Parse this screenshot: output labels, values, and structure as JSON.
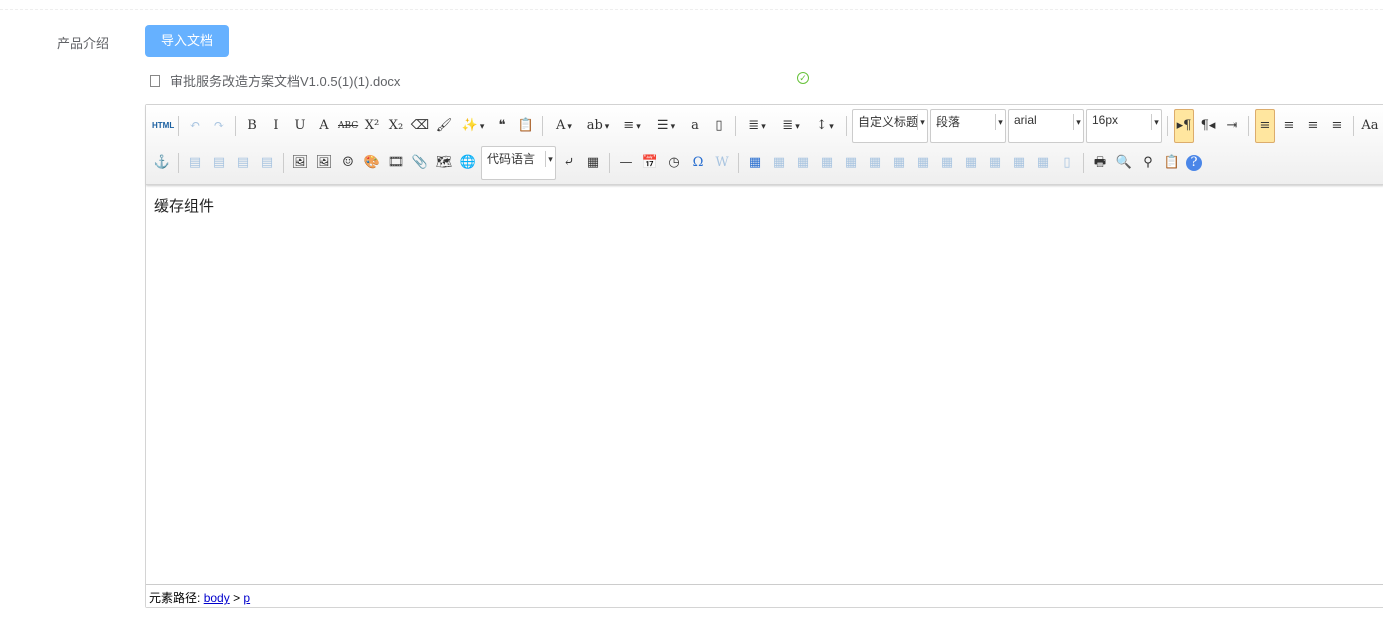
{
  "form": {
    "label": "产品介绍",
    "import_button": "导入文档",
    "file_name": "审批服务改造方案文档V1.0.5(1)(1).docx"
  },
  "toolbar": {
    "row1": [
      {
        "n": "html-source",
        "g": "HTML"
      },
      {
        "sep": 1
      },
      {
        "n": "undo",
        "g": "↶",
        "d": 1
      },
      {
        "n": "redo",
        "g": "↷",
        "d": 1
      },
      {
        "sep": 1
      },
      {
        "n": "bold",
        "g": "B"
      },
      {
        "n": "italic",
        "g": "I"
      },
      {
        "n": "underline",
        "g": "U"
      },
      {
        "n": "font-border",
        "g": "A"
      },
      {
        "n": "strikethrough",
        "g": "ABC"
      },
      {
        "n": "superscript",
        "g": "X²"
      },
      {
        "n": "subscript",
        "g": "X₂"
      },
      {
        "n": "eraser",
        "g": "⌫"
      },
      {
        "n": "format-brush",
        "g": "🖌"
      },
      {
        "n": "auto-typeset",
        "g": "✨",
        "drop": 1
      },
      {
        "n": "blockquote",
        "g": "❝"
      },
      {
        "n": "paste-plain",
        "g": "📋"
      },
      {
        "sep": 1
      },
      {
        "n": "font-color",
        "g": "A",
        "drop": 1
      },
      {
        "n": "background-color",
        "g": "ab",
        "drop": 1
      },
      {
        "n": "ordered-list",
        "g": "≡",
        "drop": 1
      },
      {
        "n": "unordered-list",
        "g": "☰",
        "drop": 1
      },
      {
        "n": "select-all",
        "g": "a"
      },
      {
        "n": "clear-doc",
        "g": "▯"
      },
      {
        "sep": 1
      },
      {
        "n": "row-spacing-top",
        "g": "≣",
        "drop": 1
      },
      {
        "n": "row-spacing-bottom",
        "g": "≣",
        "drop": 1
      },
      {
        "n": "line-height",
        "g": "↕",
        "drop": 1
      },
      {
        "sep": 1
      },
      {
        "combo": "custom_style",
        "w": 76
      },
      {
        "combo": "paragraph",
        "w": 76
      },
      {
        "combo": "font_family",
        "w": 76
      },
      {
        "combo": "font_size",
        "w": 76
      },
      {
        "sep": 1
      },
      {
        "n": "direction-ltr",
        "g": "▸¶",
        "act": 1
      },
      {
        "n": "direction-rtl",
        "g": "¶◂"
      },
      {
        "n": "indent",
        "g": "⇥"
      },
      {
        "sep": 1
      },
      {
        "n": "justify-left",
        "g": "≡",
        "act": 1
      },
      {
        "n": "justify-center",
        "g": "≡"
      },
      {
        "n": "justify-right",
        "g": "≡"
      },
      {
        "n": "justify-full",
        "g": "≡"
      },
      {
        "sep": 1
      },
      {
        "n": "touppercase",
        "g": "Aa"
      }
    ],
    "row2": [
      {
        "n": "anchor",
        "g": "⚓"
      },
      {
        "sep": 1
      },
      {
        "n": "image-none",
        "g": "▤",
        "d": 1
      },
      {
        "n": "image-left",
        "g": "▤",
        "d": 1
      },
      {
        "n": "image-right",
        "g": "▤",
        "d": 1
      },
      {
        "n": "image-center",
        "g": "▤",
        "d": 1
      },
      {
        "sep": 1
      },
      {
        "n": "simple-upload",
        "g": "🖼"
      },
      {
        "n": "insert-image",
        "g": "🖼"
      },
      {
        "n": "emotion",
        "g": "☺"
      },
      {
        "n": "scrawl",
        "g": "🎨"
      },
      {
        "n": "insert-video",
        "g": "🎞"
      },
      {
        "n": "attachment",
        "g": "📎"
      },
      {
        "n": "map",
        "g": "🗺"
      },
      {
        "n": "insert-frame",
        "g": "🌐"
      },
      {
        "combo": "code_language",
        "w": 75
      },
      {
        "n": "page-break",
        "g": "⤶"
      },
      {
        "n": "template",
        "g": "▦"
      },
      {
        "sep": 1
      },
      {
        "n": "horizontal-rule",
        "g": "—"
      },
      {
        "n": "date",
        "g": "📅"
      },
      {
        "n": "time",
        "g": "◷"
      },
      {
        "n": "special-chars",
        "g": "Ω"
      },
      {
        "n": "word-image",
        "g": "W",
        "d": 1
      },
      {
        "sep": 1
      },
      {
        "n": "insert-table",
        "g": "▦"
      },
      {
        "n": "delete-table",
        "g": "▦",
        "d": 1
      },
      {
        "n": "insert-paragraph-before-table",
        "g": "▦",
        "d": 1
      },
      {
        "n": "insert-row",
        "g": "▦",
        "d": 1
      },
      {
        "n": "delete-row",
        "g": "▦",
        "d": 1
      },
      {
        "n": "insert-col",
        "g": "▦",
        "d": 1
      },
      {
        "n": "delete-col",
        "g": "▦",
        "d": 1
      },
      {
        "n": "merge-cells",
        "g": "▦",
        "d": 1
      },
      {
        "n": "merge-right",
        "g": "▦",
        "d": 1
      },
      {
        "n": "merge-down",
        "g": "▦",
        "d": 1
      },
      {
        "n": "split-to-cells",
        "g": "▦",
        "d": 1
      },
      {
        "n": "split-to-rows",
        "g": "▦",
        "d": 1
      },
      {
        "n": "split-to-cols",
        "g": "▦",
        "d": 1
      },
      {
        "n": "charts",
        "g": "▯",
        "d": 1
      },
      {
        "sep": 1
      },
      {
        "n": "print",
        "g": "🖶"
      },
      {
        "n": "preview",
        "g": "🔍"
      },
      {
        "n": "search-replace",
        "g": "⚲"
      },
      {
        "n": "drafts",
        "g": "📋"
      },
      {
        "n": "help",
        "g": "?"
      }
    ]
  },
  "combos": {
    "custom_style": "自定义标题",
    "paragraph": "段落",
    "font_family": "arial",
    "font_size": "16px",
    "code_language": "代码语言"
  },
  "content": {
    "text": "缓存组件"
  },
  "status": {
    "label": "元素路径:",
    "path1": "body",
    "sep": ">",
    "path2": "p"
  }
}
